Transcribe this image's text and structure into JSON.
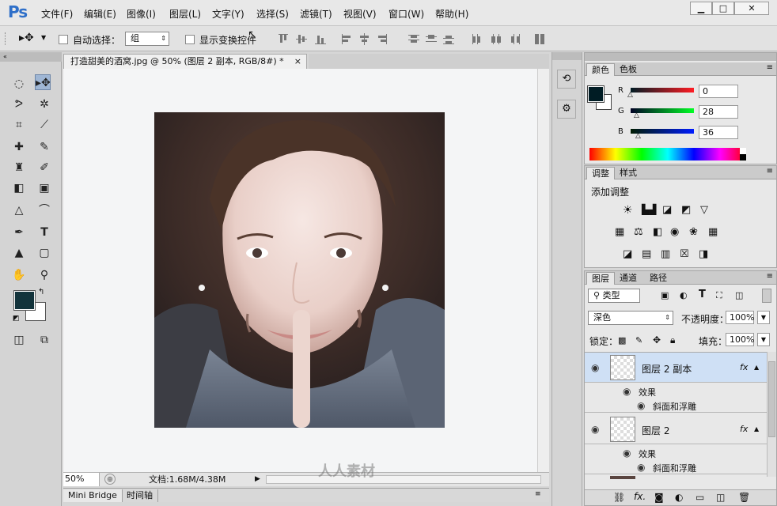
{
  "app": {
    "logo": "Ps"
  },
  "menu": [
    "文件(F)",
    "编辑(E)",
    "图像(I)",
    "图层(L)",
    "文字(Y)",
    "选择(S)",
    "滤镜(T)",
    "视图(V)",
    "窗口(W)",
    "帮助(H)"
  ],
  "window_controls": {
    "minimize": "▁",
    "restore": "□",
    "close": "✕"
  },
  "options": {
    "auto_select_label": "自动选择：",
    "auto_select_value": "组",
    "show_transform_label": "显示变换控件"
  },
  "document": {
    "tab_title": "打造甜美的酒窝.jpg @ 50% (图层 2 副本, RGB/8#) *",
    "tab_close": "×",
    "zoom": "50%",
    "doc_info": "文档:1.68M/4.38M"
  },
  "bottom_tabs": [
    "Mini Bridge",
    "时间轴"
  ],
  "color_panel": {
    "tabs": [
      "颜色",
      "色板"
    ],
    "r_label": "R",
    "g_label": "G",
    "b_label": "B",
    "r_value": "0",
    "g_value": "28",
    "b_value": "36",
    "fg_color": "#001c24"
  },
  "adjust_panel": {
    "tabs": [
      "调整",
      "样式"
    ],
    "title": "添加调整"
  },
  "layers_panel": {
    "tabs": [
      "图层",
      "通道",
      "路径"
    ],
    "filter_kind": "类型",
    "blend_mode": "深色",
    "opacity_label": "不透明度：",
    "opacity_value": "100%",
    "lock_label": "锁定：",
    "fill_label": "填充：",
    "fill_value": "100%",
    "layers": [
      {
        "name": "图层 2 副本",
        "effects_label": "效果",
        "effect": "斜面和浮雕",
        "selected": true
      },
      {
        "name": "图层 2",
        "effects_label": "效果",
        "effect": "斜面和浮雕",
        "selected": false
      }
    ],
    "fx": "fx"
  },
  "watermark": "人人素材"
}
